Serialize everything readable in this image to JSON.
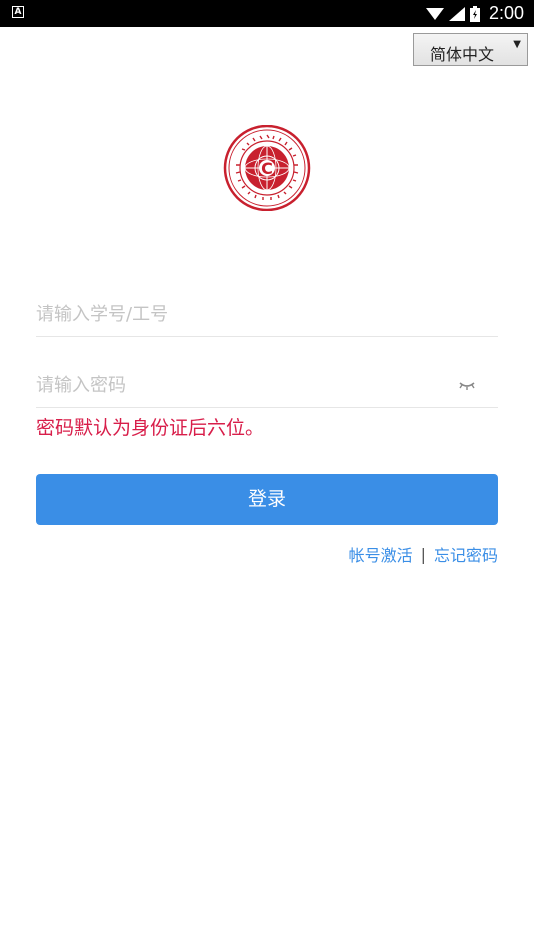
{
  "status_bar": {
    "left_icon_letter": "A",
    "time": "2:00"
  },
  "language_select": {
    "selected": "简体中文",
    "arrow": "▼"
  },
  "logo": {
    "letter": "C",
    "name": "college-logo"
  },
  "login_form": {
    "username_placeholder": "请输入学号/工号",
    "password_placeholder": "请输入密码",
    "password_hint": "密码默认为身份证后六位。",
    "login_label": "登录"
  },
  "links": {
    "activate": "帐号激活",
    "separator": "|",
    "forgot": "忘记密码"
  },
  "colors": {
    "primary": "#3a8ee6",
    "hint": "#d81e4a",
    "logo_red": "#c8202e"
  }
}
